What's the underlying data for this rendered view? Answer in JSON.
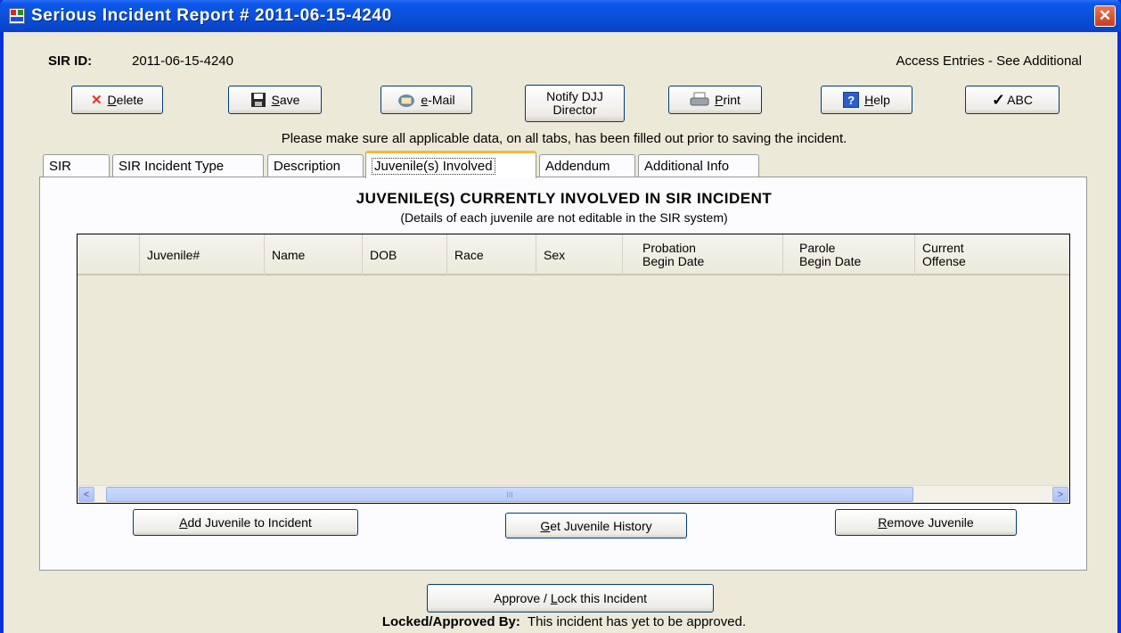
{
  "window": {
    "title": "Serious Incident Report # 2011-06-15-4240",
    "close_glyph": "✕"
  },
  "header": {
    "sir_id_label": "SIR ID:",
    "sir_id_value": "2011-06-15-4240",
    "access_entries": "Access Entries - See Additional"
  },
  "toolbar": {
    "delete_label": "elete",
    "delete_mnemonic": "D",
    "save_label": "ave",
    "save_mnemonic": "S",
    "email_label": "-Mail",
    "email_mnemonic": "e",
    "notify_line1": "Notify DJJ",
    "notify_line2": "Director",
    "print_label": "rint",
    "print_mnemonic": "P",
    "help_label": "elp",
    "help_mnemonic": "H",
    "abc_label": "ABC"
  },
  "notice": "Please make sure all applicable data, on all tabs, has been filled out prior to saving the incident.",
  "tabs": [
    {
      "label": "SIR"
    },
    {
      "label": "SIR Incident Type"
    },
    {
      "label": "Description"
    },
    {
      "label": "Juvenile(s) Involved"
    },
    {
      "label": "Addendum"
    },
    {
      "label": "Additional Info"
    }
  ],
  "juveniles": {
    "heading": "JUVENILE(S) CURRENTLY INVOLVED IN SIR INCIDENT",
    "subheading": "(Details of each juvenile are not editable in the SIR system)",
    "columns": [
      {
        "line1": "Juvenile#",
        "line2": ""
      },
      {
        "line1": "Name",
        "line2": ""
      },
      {
        "line1": "DOB",
        "line2": ""
      },
      {
        "line1": "Race",
        "line2": ""
      },
      {
        "line1": "Sex",
        "line2": ""
      },
      {
        "line1": "Probation",
        "line2": "Begin Date"
      },
      {
        "line1": "Parole",
        "line2": "Begin Date"
      },
      {
        "line1": "Current",
        "line2": "Offense"
      }
    ],
    "add_label": "dd Juvenile to Incident",
    "add_mnemonic": "A",
    "history_label": "et Juvenile History",
    "history_mnemonic": "G",
    "remove_label": "emove Juvenile",
    "remove_mnemonic": "R",
    "scroll_left": "<",
    "scroll_right": ">",
    "scroll_grip": "III"
  },
  "footer": {
    "approve_label_pre": "Approve / ",
    "approve_mnemonic": "L",
    "approve_label_post": "ock this Incident",
    "locked_label": "Locked/Approved By:",
    "locked_value": "This incident has yet to be approved."
  }
}
